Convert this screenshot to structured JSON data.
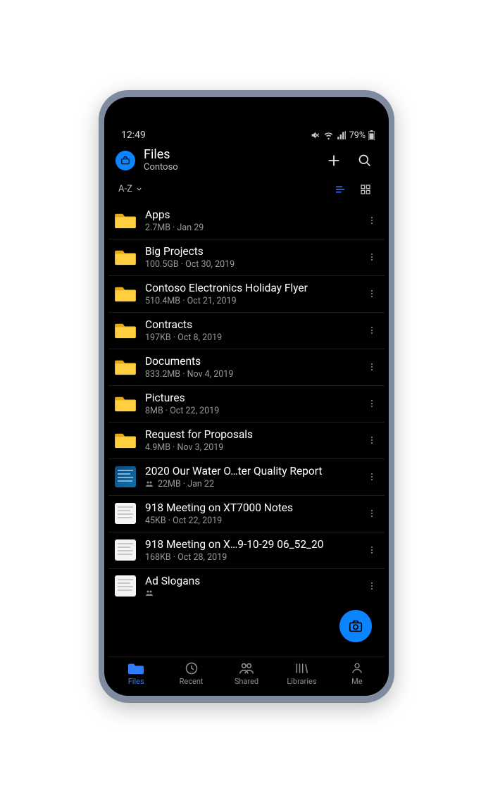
{
  "status": {
    "time": "12:49",
    "battery_text": "79%"
  },
  "appbar": {
    "title": "Files",
    "subtitle": "Contoso"
  },
  "sort": {
    "label": "A-Z"
  },
  "items": [
    {
      "type": "folder",
      "name": "Apps",
      "meta": "2.7MB · Jan 29",
      "shared": false
    },
    {
      "type": "folder",
      "name": "Big Projects",
      "meta": "100.5GB · Oct 30, 2019",
      "shared": false
    },
    {
      "type": "folder",
      "name": "Contoso Electronics Holiday Flyer",
      "meta": "510.4MB · Oct 21, 2019",
      "shared": false
    },
    {
      "type": "folder",
      "name": "Contracts",
      "meta": "197KB · Oct 8, 2019",
      "shared": false
    },
    {
      "type": "folder",
      "name": "Documents",
      "meta": "833.2MB · Nov 4, 2019",
      "shared": false
    },
    {
      "type": "folder",
      "name": "Pictures",
      "meta": "8MB · Oct 22, 2019",
      "shared": false
    },
    {
      "type": "folder",
      "name": "Request for Proposals",
      "meta": "4.9MB · Nov 3, 2019",
      "shared": false
    },
    {
      "type": "file",
      "name": "2020 Our Water O…ter Quality Report",
      "meta": "22MB · Jan 22",
      "shared": true,
      "thumb": "blue"
    },
    {
      "type": "file",
      "name": "918 Meeting on XT7000 Notes",
      "meta": "45KB · Oct 22, 2019",
      "shared": false,
      "thumb": "doc"
    },
    {
      "type": "file",
      "name": "918 Meeting on X…9-10-29 06_52_20",
      "meta": "168KB · Oct 28, 2019",
      "shared": false,
      "thumb": "doc"
    },
    {
      "type": "file",
      "name": "Ad Slogans",
      "meta": "",
      "shared": true,
      "thumb": "doc"
    }
  ],
  "nav": {
    "items": [
      {
        "id": "files",
        "label": "Files",
        "active": true
      },
      {
        "id": "recent",
        "label": "Recent",
        "active": false
      },
      {
        "id": "shared",
        "label": "Shared",
        "active": false
      },
      {
        "id": "libraries",
        "label": "Libraries",
        "active": false
      },
      {
        "id": "me",
        "label": "Me",
        "active": false
      }
    ]
  }
}
